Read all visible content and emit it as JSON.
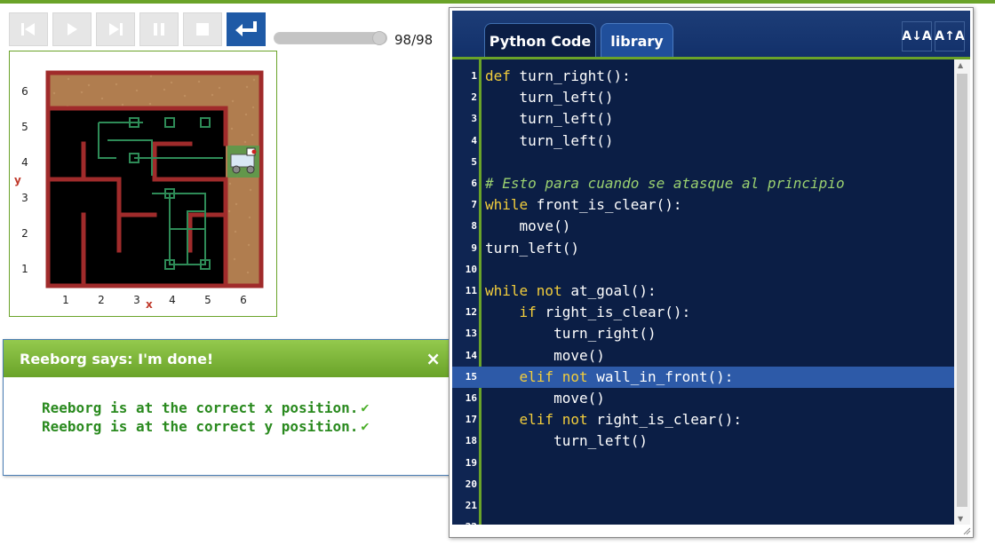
{
  "toolbar": {
    "buttons": [
      {
        "name": "reverse-step",
        "icon": "skip-back-icon",
        "enabled": false
      },
      {
        "name": "run",
        "icon": "play-icon",
        "enabled": false
      },
      {
        "name": "step",
        "icon": "skip-forward-icon",
        "enabled": false
      },
      {
        "name": "pause",
        "icon": "pause-icon",
        "enabled": false
      },
      {
        "name": "stop",
        "icon": "stop-icon",
        "enabled": false
      },
      {
        "name": "reload",
        "icon": "return-icon",
        "enabled": true
      }
    ],
    "step_slider": {
      "value": 98,
      "max": 98
    },
    "step_counter": "98/98"
  },
  "world": {
    "y_ticks": [
      "6",
      "5",
      "4",
      "3",
      "2",
      "1"
    ],
    "x_ticks": [
      "1",
      "2",
      "3",
      "4",
      "5",
      "6"
    ],
    "x_axis_label": "x",
    "y_axis_label": "y",
    "robot": {
      "x": 6,
      "y": 4,
      "icon": "robot-icon"
    },
    "colors": {
      "wall": "#a02b2b",
      "trace": "#2e8b57",
      "ground": "#b07d4f",
      "floor": "#000000"
    }
  },
  "dialog": {
    "title": "Reeborg says: I'm done!",
    "close_label": "×",
    "messages": [
      "Reeborg is at the correct x position.",
      "Reeborg is at the correct y position."
    ],
    "check_icon": "✔"
  },
  "editor": {
    "tabs": [
      "Python Code",
      "library"
    ],
    "active_tab": "Python Code",
    "font_buttons": [
      {
        "name": "decrease-font-button",
        "label": "A↓A"
      },
      {
        "name": "increase-font-button",
        "label": "A↑A"
      }
    ],
    "highlighted_line": 15,
    "lines": [
      [
        {
          "t": "def ",
          "c": "kw"
        },
        {
          "t": "turn_right",
          "c": "fn"
        },
        {
          "t": "():",
          "c": "fn"
        }
      ],
      [
        {
          "t": "    turn_left()",
          "c": "fn"
        }
      ],
      [
        {
          "t": "    turn_left()",
          "c": "fn"
        }
      ],
      [
        {
          "t": "    turn_left()",
          "c": "fn"
        }
      ],
      [],
      [
        {
          "t": "# Esto para cuando se atasque al principio",
          "c": "cm"
        }
      ],
      [
        {
          "t": "while ",
          "c": "kw"
        },
        {
          "t": "front_is_clear():",
          "c": "fn"
        }
      ],
      [
        {
          "t": "    move()",
          "c": "fn"
        }
      ],
      [
        {
          "t": "turn_left()",
          "c": "fn"
        }
      ],
      [],
      [
        {
          "t": "while ",
          "c": "kw"
        },
        {
          "t": "not ",
          "c": "kw"
        },
        {
          "t": "at_goal():",
          "c": "fn"
        }
      ],
      [
        {
          "t": "    ",
          "c": "fn"
        },
        {
          "t": "if ",
          "c": "kw"
        },
        {
          "t": "right_is_clear():",
          "c": "fn"
        }
      ],
      [
        {
          "t": "        turn_right()",
          "c": "fn"
        }
      ],
      [
        {
          "t": "        move()",
          "c": "fn"
        }
      ],
      [
        {
          "t": "    ",
          "c": "fn"
        },
        {
          "t": "elif ",
          "c": "kw"
        },
        {
          "t": "not ",
          "c": "kw"
        },
        {
          "t": "wall_in_front():",
          "c": "fn"
        }
      ],
      [
        {
          "t": "        move()",
          "c": "fn"
        }
      ],
      [
        {
          "t": "    ",
          "c": "fn"
        },
        {
          "t": "elif ",
          "c": "kw"
        },
        {
          "t": "not ",
          "c": "kw"
        },
        {
          "t": "right_is_clear():",
          "c": "fn"
        }
      ],
      [
        {
          "t": "        turn_left()",
          "c": "fn"
        }
      ],
      [],
      [],
      [],
      []
    ]
  }
}
